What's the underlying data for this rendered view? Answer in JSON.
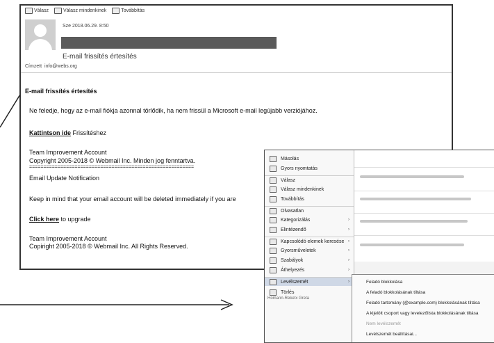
{
  "email": {
    "actions": [
      "Válasz",
      "Válasz mindenkinek",
      "Továbbítás"
    ],
    "date": "Sze 2018.06.29. 8:50",
    "subject": "E-mail frissítés értesítés",
    "to_label": "Címzett",
    "to_address": "info@webs.org",
    "body": {
      "heading": "E-mail frissítés értesítés",
      "p1": "Ne feledje, hogy az e-mail fiókja azonnal törlődik, ha nem frissül a Microsoft e-mail legújabb verziójához.",
      "link1": "Kattintson ide",
      "link1_suffix": " Frissítéshez",
      "team1": "Team Improvement Account",
      "copy1": "Copyright 2005-2018 © Webmail Inc. Minden jog fenntartva.",
      "divider": "==========================================================",
      "heading2": "Email Update Notification",
      "p2": "Keep in mind that your email account will be deleted immediately if you are",
      "link2": "Click here",
      "link2_suffix": " to upgrade",
      "team2": "Team Improvement Account",
      "copy2": "Copiright 2005-2018 © Webmail Inc. All Rights Reserved."
    }
  },
  "context_menu": {
    "items": [
      {
        "label": "Másolás",
        "arrow": ""
      },
      {
        "label": "Gyors nyomtatás",
        "arrow": ""
      },
      {
        "label": "Válasz",
        "arrow": ""
      },
      {
        "label": "Válasz mindenkinek",
        "arrow": ""
      },
      {
        "label": "Továbbítás",
        "arrow": ""
      },
      {
        "label": "Olvasatlan",
        "arrow": ""
      },
      {
        "label": "Kategorizálás",
        "arrow": "›"
      },
      {
        "label": "Elintézendő",
        "arrow": "›"
      },
      {
        "label": "Kapcsolódó elemek keresése",
        "arrow": "›"
      },
      {
        "label": "Gyorsműveletek",
        "arrow": "›"
      },
      {
        "label": "Szabályok",
        "arrow": "›"
      },
      {
        "label": "Áthelyezés",
        "arrow": "›"
      },
      {
        "label": "Levélszemét",
        "arrow": "›"
      },
      {
        "label": "Törlés",
        "arrow": ""
      }
    ],
    "bottom_text": "Homann-Reketx Greta",
    "submenu": [
      {
        "label": "Feladó blokkolása",
        "disabled": false
      },
      {
        "label": "A feladó blokkolásának tiltása",
        "disabled": false
      },
      {
        "label": "Feladó tartomány (@example.com) blokkolásának tiltása",
        "disabled": false
      },
      {
        "label": "A kijelölt csoport vagy levelezőlista blokkolásának tiltása",
        "disabled": false
      },
      {
        "label": "Nem levélszemét",
        "disabled": true
      },
      {
        "label": "Levélszemét beállításai...",
        "disabled": false
      }
    ]
  }
}
